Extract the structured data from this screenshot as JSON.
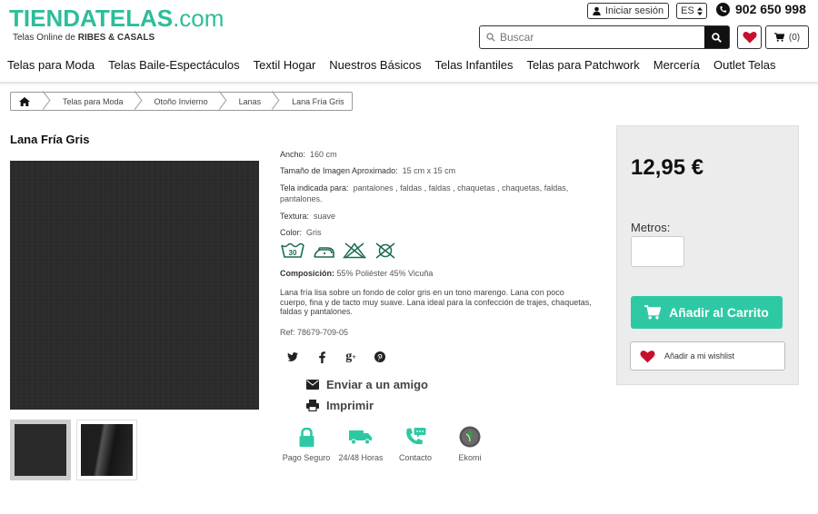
{
  "header": {
    "logo_main": "TIENDATELAS",
    "logo_suffix": ".com",
    "tagline_prefix": "Telas Online de ",
    "tagline_brand": "RIBES & CASALS",
    "login_label": "Iniciar sesión",
    "language": "ES",
    "phone": "902 650 998",
    "search_placeholder": "Buscar",
    "cart_count": "(0)"
  },
  "nav": {
    "items": [
      "Telas para Moda",
      "Telas Baile-Espectáculos",
      "Textil Hogar",
      "Nuestros Básicos",
      "Telas Infantiles",
      "Telas para Patchwork",
      "Mercería",
      "Outlet Telas"
    ]
  },
  "breadcrumb": [
    "Telas para Moda",
    "Otoño Invierno",
    "Lanas",
    "Lana Fría Gris"
  ],
  "product": {
    "title": "Lana Fría Gris",
    "ancho_label": "Ancho:",
    "ancho_value": "160 cm",
    "tamano_label": "Tamaño de Imagen Aproximado:",
    "tamano_value": "15 cm x 15 cm",
    "indicada_label": "Tela indicada para:",
    "indicada_value": "pantalones , faldas , faldas , chaquetas , chaquetas, faldas, pantalones.",
    "textura_label": "Textura:",
    "textura_value": "suave",
    "color_label": "Color:",
    "color_value": "Gris",
    "care_icons": [
      "wash-30-icon",
      "iron-low-icon",
      "no-bleach-icon",
      "no-tumble-dry-icon"
    ],
    "wash_temp": "30",
    "comp_label": "Composición:",
    "comp_value": "55% Poliéster 45% Vicuña",
    "description": "Lana fría lisa sobre un fondo de color gris en un tono marengo. Lana con poco cuerpo, fina y de tacto muy suave. Lana ideal para la confección de trajes, chaquetas, faldas y pantalones.",
    "ref": "Ref: 78679-709-05"
  },
  "actions": {
    "send_friend": "Enviar a un amigo",
    "print": "Imprimir"
  },
  "features": [
    {
      "label": "Pago Seguro",
      "icon": "lock-icon"
    },
    {
      "label": "24/48 Horas",
      "icon": "truck-icon"
    },
    {
      "label": "Contacto",
      "icon": "phone-chat-icon"
    },
    {
      "label": "Ekomi",
      "icon": "ekomi-icon"
    }
  ],
  "buy": {
    "price": "12,95 €",
    "qty_label": "Metros:",
    "add_to_cart": "Añadir al Carrito",
    "wishlist": "Añadir a mi wishlist"
  },
  "colors": {
    "accent": "#2ec9a4",
    "logo": "#2ebd9a",
    "heart": "#c8102e"
  }
}
